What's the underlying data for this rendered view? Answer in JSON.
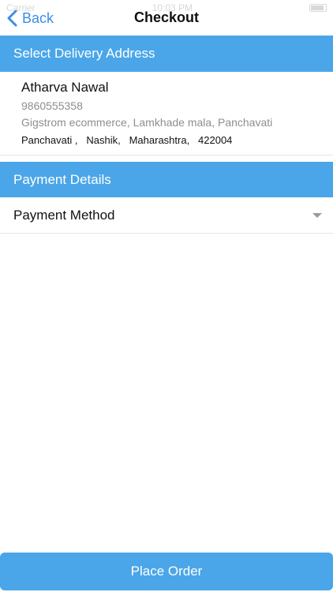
{
  "status_bar": {
    "carrier": "Carrier",
    "time": "10:03 PM"
  },
  "nav": {
    "back_label": "Back",
    "title": "Checkout"
  },
  "sections": {
    "address_header": "Select Delivery Address",
    "payment_header": "Payment Details"
  },
  "address": {
    "name": "Atharva Nawal",
    "phone": "9860555358",
    "line": "Gigstrom ecommerce, Lamkhade mala, Panchavati",
    "area": "Panchavati ,",
    "city": "Nashik,",
    "state": "Maharashtra,",
    "pincode": "422004"
  },
  "payment": {
    "method_label": "Payment Method"
  },
  "actions": {
    "place_order_label": "Place Order"
  },
  "colors": {
    "accent": "#4aa6e8",
    "link": "#3a8ee6",
    "muted_text": "#8e8e93"
  }
}
